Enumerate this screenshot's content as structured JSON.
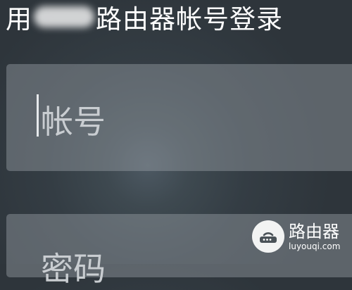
{
  "header": {
    "title_prefix": "用",
    "title_suffix": "路由器帐号登录"
  },
  "form": {
    "account_placeholder": "帐号",
    "password_placeholder": "密码"
  },
  "watermark": {
    "icon": "router-icon",
    "name": "路由器",
    "url": "luyouqi.com"
  }
}
